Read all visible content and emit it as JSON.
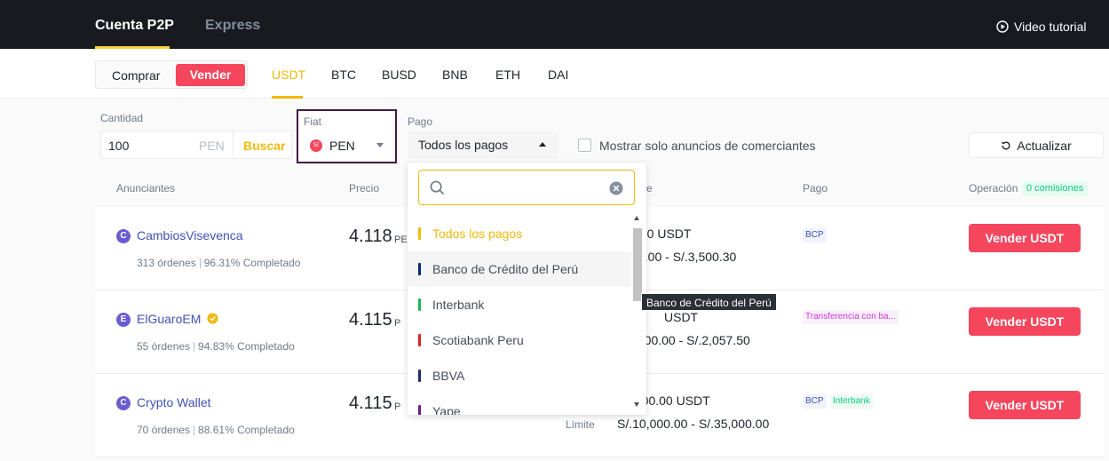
{
  "topbar": {
    "tab_active": "Cuenta P2P",
    "tab_other": "Express",
    "video": "Video tutorial"
  },
  "trade_toggle": {
    "buy": "Comprar",
    "sell": "Vender"
  },
  "coins": [
    "USDT",
    "BTC",
    "BUSD",
    "BNB",
    "ETH",
    "DAI"
  ],
  "filters": {
    "amount_label": "Cantidad",
    "amount_value": "100",
    "amount_unit": "PEN",
    "search_button": "Buscar",
    "fiat_label": "Fiat",
    "fiat_value": "PEN",
    "fiat_flag": "S/",
    "pay_label": "Pago",
    "pay_value": "Todos los pagos",
    "merchant_only": "Mostrar solo anuncios de comerciantes",
    "refresh": "Actualizar"
  },
  "table_headers": {
    "advertisers": "Anunciantes",
    "price": "Precio",
    "limit": "e",
    "payment": "Pago",
    "operation": "Operación",
    "fee_badge": "0 comisiones"
  },
  "rows": [
    {
      "avatar": "C",
      "name": "CambiosVisevenca",
      "orders": "313 órdenes",
      "completion": "96.31% Completado",
      "price": "4.118",
      "unit": "PE",
      "available": ".00 USDT",
      "limit": "0.00 - S/.3,500.30",
      "limit_label": "",
      "payments": [
        "BCP"
      ],
      "button": "Vender USDT"
    },
    {
      "avatar": "E",
      "name": "ElGuaroEM",
      "orders": "55 órdenes",
      "completion": "94.83% Completado",
      "price": "4.115",
      "unit": "P",
      "available": "USDT",
      "limit": ".000.00 - S/.2,057.50",
      "limit_label": "",
      "payments": [
        "Transferencia con ba..."
      ],
      "button": "Vender USDT"
    },
    {
      "avatar": "C",
      "name": "Crypto Wallet",
      "orders": "70 órdenes",
      "completion": "88.61% Completado",
      "price": "4.115",
      "unit": "P",
      "available": ",000.00 USDT",
      "limit": "S/.10,000.00 - S/.35,000.00",
      "limit_label": "Límite",
      "payments": [
        "BCP",
        "Interbank"
      ],
      "button": "Vender USDT"
    }
  ],
  "dropdown": {
    "search_placeholder": "",
    "items": [
      {
        "label": "Todos los pagos",
        "color": "#f0b90b"
      },
      {
        "label": "Banco de Crédito del Perú",
        "color": "#0a2a78"
      },
      {
        "label": "Interbank",
        "color": "#1bb85a"
      },
      {
        "label": "Scotiabank Peru",
        "color": "#e02020"
      },
      {
        "label": "BBVA",
        "color": "#1a2d6b"
      },
      {
        "label": "Yape",
        "color": "#6b1e8a"
      }
    ]
  },
  "tooltip": "Banco de Crédito del Perú",
  "colors": {
    "accent": "#f0b90b",
    "sell": "#f6465d",
    "dark": "#181a20"
  }
}
